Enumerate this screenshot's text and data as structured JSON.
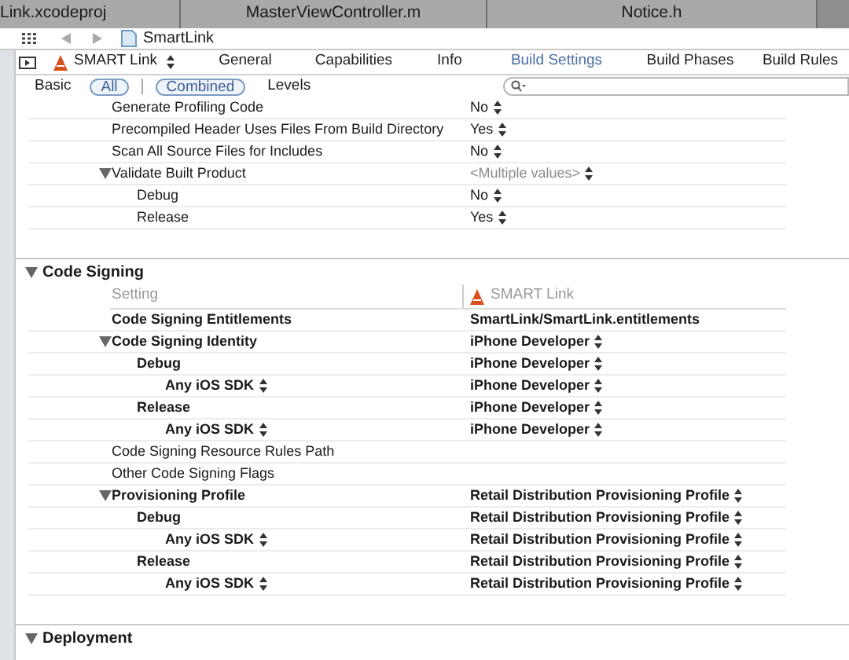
{
  "file_tabs": [
    {
      "label": "Link.xcodeproj"
    },
    {
      "label": "MasterViewController.m"
    },
    {
      "label": "Notice.h"
    }
  ],
  "jump_bar": {
    "label": "SmartLink"
  },
  "editor_tabs": {
    "target": "SMART Link",
    "tabs": [
      {
        "label": "General",
        "selected": false
      },
      {
        "label": "Capabilities",
        "selected": false
      },
      {
        "label": "Info",
        "selected": false
      },
      {
        "label": "Build Settings",
        "selected": true
      },
      {
        "label": "Build Phases",
        "selected": false
      },
      {
        "label": "Build Rules",
        "selected": false
      }
    ]
  },
  "filters": {
    "scope": [
      {
        "label": "Basic",
        "selected": false
      },
      {
        "label": "All",
        "selected": true
      }
    ],
    "display": [
      {
        "label": "Combined",
        "selected": true
      },
      {
        "label": "Levels",
        "selected": false
      }
    ]
  },
  "sections": [
    {
      "rows": [
        {
          "label": "Generate Profiling Code",
          "value": "No",
          "popup": true,
          "customized": false
        },
        {
          "label": "Precompiled Header Uses Files From Build Directory",
          "value": "Yes",
          "popup": true,
          "customized": false
        },
        {
          "label": "Scan All Source Files for Includes",
          "value": "No",
          "popup": true,
          "customized": false
        },
        {
          "label": "Validate Built Product",
          "value": "<Multiple values>",
          "popup": true,
          "customized": false,
          "muted": true,
          "expanded": true,
          "children": [
            {
              "label": "Debug",
              "value": "No",
              "popup": true,
              "customized": false
            },
            {
              "label": "Release",
              "value": "Yes",
              "popup": true,
              "customized": false
            }
          ]
        }
      ]
    },
    {
      "title": "Code Signing",
      "expanded": true,
      "header": {
        "setting": "Setting",
        "target": "SMART Link"
      },
      "rows": [
        {
          "label": "Code Signing Entitlements",
          "value": "SmartLink/SmartLink.entitlements",
          "popup": false,
          "customized": true
        },
        {
          "label": "Code Signing Identity",
          "value": "iPhone Developer",
          "popup": true,
          "customized": true,
          "expanded": true,
          "children": [
            {
              "label": "Debug",
              "value": "iPhone Developer",
              "popup": true,
              "customized": true,
              "children": [
                {
                  "label": "Any iOS SDK",
                  "label_popup": true,
                  "value": "iPhone Developer",
                  "popup": true,
                  "customized": true
                }
              ]
            },
            {
              "label": "Release",
              "value": "iPhone Developer",
              "popup": true,
              "customized": true,
              "children": [
                {
                  "label": "Any iOS SDK",
                  "label_popup": true,
                  "value": "iPhone Developer",
                  "popup": true,
                  "customized": true
                }
              ]
            }
          ]
        },
        {
          "label": "Code Signing Resource Rules Path",
          "customized": false
        },
        {
          "label": "Other Code Signing Flags",
          "customized": false
        },
        {
          "label": "Provisioning Profile",
          "value": "Retail Distribution Provisioning Profile",
          "popup": true,
          "customized": true,
          "expanded": true,
          "children": [
            {
              "label": "Debug",
              "value": "Retail Distribution Provisioning Profile",
              "popup": true,
              "customized": true,
              "children": [
                {
                  "label": "Any iOS SDK",
                  "label_popup": true,
                  "value": "Retail Distribution Provisioning Profile",
                  "popup": true,
                  "customized": true
                }
              ]
            },
            {
              "label": "Release",
              "value": "Retail Distribution Provisioning Profile",
              "popup": true,
              "customized": true,
              "children": [
                {
                  "label": "Any iOS SDK",
                  "label_popup": true,
                  "value": "Retail Distribution Provisioning Profile",
                  "popup": true,
                  "customized": true
                }
              ]
            }
          ]
        }
      ]
    },
    {
      "title": "Deployment",
      "expanded": true
    }
  ]
}
